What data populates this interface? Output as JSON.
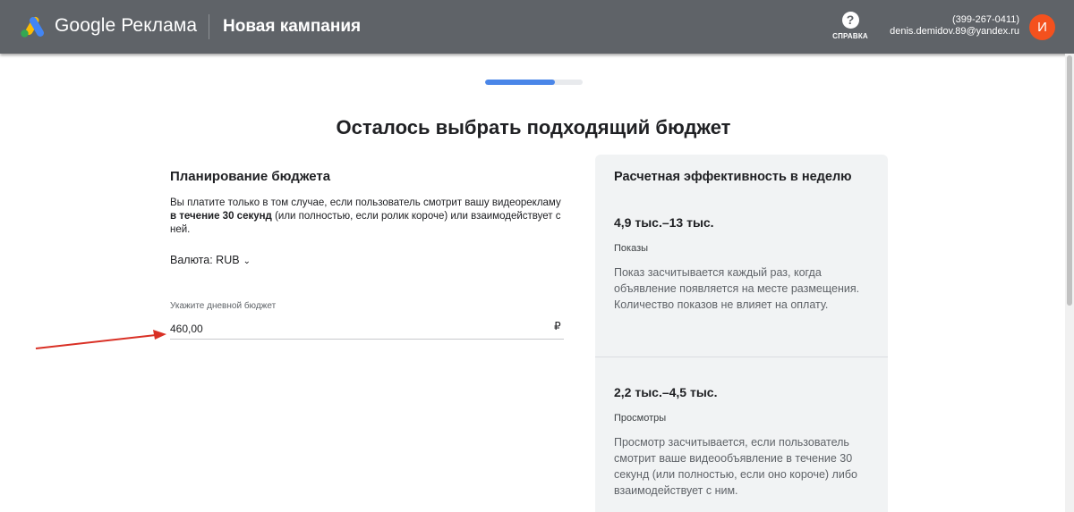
{
  "header": {
    "brand": "Google Реклама",
    "page_name": "Новая кампания",
    "help_label": "СПРАВКА",
    "help_icon": "?",
    "account_id": "(399-267-0411)",
    "email": "denis.demidov.89@yandex.ru",
    "avatar_letter": "И"
  },
  "progress": {
    "value_percent": 72
  },
  "main": {
    "title": "Осталось выбрать подходящий бюджет"
  },
  "planning": {
    "title": "Планирование бюджета",
    "desc_part1": "Вы платите только в том случае, если пользователь смотрит вашу видеорекламу ",
    "desc_bold": "в течение 30 секунд",
    "desc_part2": " (или полностью, если ролик короче) или взаимодействует с ней.",
    "currency_label": "Валюта: RUB",
    "budget_label": "Укажите дневной бюджет",
    "budget_value": "460,00",
    "currency_symbol": "₽"
  },
  "performance": {
    "title": "Расчетная эффективность в неделю",
    "metrics": [
      {
        "range": "4,9 тыс.–13 тыс.",
        "name": "Показы",
        "desc": "Показ засчитывается каждый раз, когда объявление появляется на месте размещения. Количество показов не влияет на оплату."
      },
      {
        "range": "2,2 тыс.–4,5 тыс.",
        "name": "Просмотры",
        "desc": "Просмотр засчитывается, если пользователь смотрит ваше видеообъявление в течение 30 секунд (или полностью, если оно короче) либо взаимодействует с ним."
      }
    ]
  },
  "colors": {
    "header_bg": "#5f6368",
    "progress_fill": "#4a86e8",
    "avatar_bg": "#f4511e",
    "arrow": "#d93025",
    "panel_bg": "#f1f3f4"
  }
}
